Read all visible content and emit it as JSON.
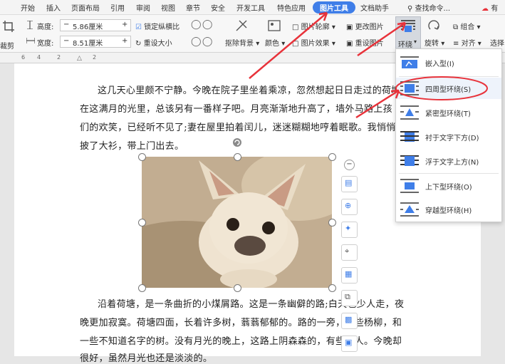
{
  "tabs": [
    "开始",
    "插入",
    "页面布局",
    "引用",
    "审阅",
    "视图",
    "章节",
    "安全",
    "开发工具",
    "特色应用",
    "图片工具",
    "文档助手"
  ],
  "search_label": "查找命令...",
  "account_label": "有",
  "toolbar": {
    "crop_label": "裁剪",
    "height_label": "高度:",
    "height_value": "5.86厘米",
    "width_label": "宽度:",
    "width_value": "8.51厘米",
    "lock_ratio_label": "锁定纵横比",
    "reset_size_label": "重设大小",
    "remove_bg_label": "抠除背景",
    "color_label": "颜色",
    "outline_label": "图片轮廓",
    "effects_label": "图片效果",
    "change_label": "更改图片",
    "reset_label": "重设图片",
    "wrap_label": "环绕",
    "rotate_label": "旋转",
    "group_label": "组合",
    "align_label": "对齐",
    "select_label": "选择"
  },
  "ruler_labels": [
    "6",
    "4",
    "2",
    "2"
  ],
  "paragraphs": [
    "这几天心里颇不宁静。今晚在院子里坐着乘凉，忽然想起日日走过的荷塘",
    "在这满月的光里，总该另有一番样子吧。月亮渐渐地升高了，墙外马路上孩",
    "们的欢笑，已经听不见了;妻在屋里拍着闰儿，迷迷糊糊地哼着眠歌。我悄悄",
    "披了大衫，带上门出去。",
    "沿着荷塘，是一条曲折的小煤屑路。这是一条幽僻的路;白天也少人走，夜",
    "晚更加寂寞。荷塘四面，长着许多树，蓊蓊郁郁的。路的一旁，是些杨柳，和",
    "一些不知道名字的树。没有月光的晚上，这路上阴森森的，有些怕人。今晚却",
    "很好，虽然月光也还是淡淡的。"
  ],
  "wrap_menu": [
    {
      "label": "嵌入型(I)",
      "icon": "inline-wrap-icon"
    },
    {
      "label": "四周型环绕(S)",
      "icon": "square-wrap-icon",
      "highlighted": true
    },
    {
      "label": "紧密型环绕(T)",
      "icon": "tight-wrap-icon"
    },
    {
      "label": "衬于文字下方(D)",
      "icon": "behind-text-icon"
    },
    {
      "label": "浮于文字上方(N)",
      "icon": "in-front-text-icon"
    },
    {
      "label": "上下型环绕(O)",
      "icon": "top-bottom-wrap-icon"
    },
    {
      "label": "穿越型环绕(H)",
      "icon": "through-wrap-icon"
    }
  ],
  "colors": {
    "accent": "#3f7ee8",
    "annotation": "#e8323a"
  }
}
